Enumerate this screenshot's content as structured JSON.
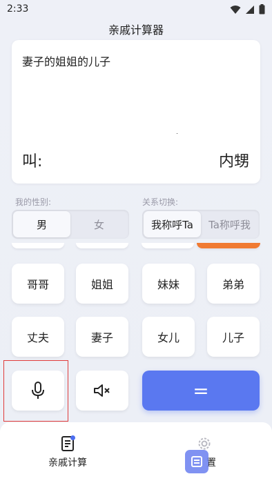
{
  "status_bar": {
    "time": "2:33"
  },
  "app": {
    "title": "亲戚计算器"
  },
  "display": {
    "query": "妻子的姐姐的儿子",
    "result_label": "叫:",
    "result_value": "内甥"
  },
  "gender": {
    "label": "我的性别:",
    "options": [
      "男",
      "女"
    ],
    "selected": "男"
  },
  "relation_switch": {
    "label": "关系切换:",
    "options": [
      "我称呼Ta",
      "Ta称呼我"
    ],
    "selected": "我称呼Ta"
  },
  "keys": {
    "row1": [
      "哥哥",
      "姐姐",
      "妹妹",
      "弟弟"
    ],
    "row2": [
      "丈夫",
      "妻子",
      "女儿",
      "儿子"
    ],
    "equal": "="
  },
  "colors": {
    "accent_blue": "#5a78f0",
    "accent_orange": "#f07a32",
    "highlight_red": "#e03a3a"
  },
  "icons": {
    "voice": "microphone-icon",
    "mute": "speaker-mute-icon",
    "calc_tab": "calculator-doc-icon",
    "settings_tab": "gear-icon"
  },
  "nav": {
    "tabs": [
      {
        "label": "亲戚计算"
      },
      {
        "label": "置"
      }
    ]
  }
}
